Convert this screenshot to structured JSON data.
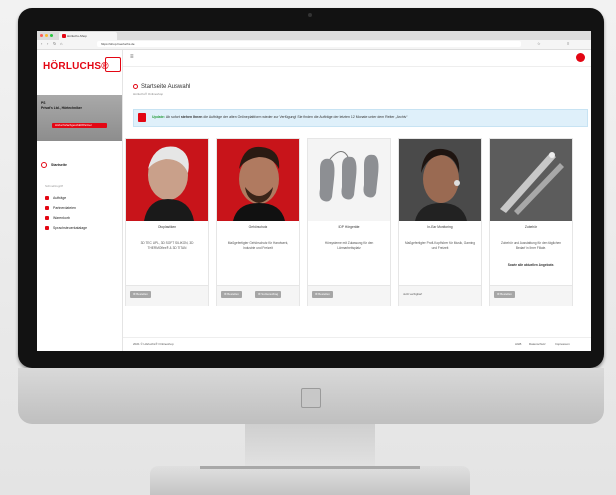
{
  "browser": {
    "tab_title": "Hörluchs-Shop",
    "url": "https://shop.hoerluchs.de"
  },
  "brand": {
    "logo_text": "HÖRLUCHS®",
    "accent": "#e30613"
  },
  "user": {
    "line1": "PS",
    "line2": "Privat's Ltd., Hörtechniker",
    "badge": "Hörluchsfachgeschäft/Partner"
  },
  "sidebar": {
    "home_label": "Startseite",
    "section_label": "Schnellzugriff",
    "items": [
      {
        "label": "Aufträge"
      },
      {
        "label": "Partnerdateien"
      },
      {
        "label": "Warenkorb"
      },
      {
        "label": "Sprachsteuerkatalage"
      }
    ]
  },
  "page": {
    "title": "Startseite Auswahl",
    "breadcrumb": "Hörluchs® Onlineshop"
  },
  "alert": {
    "prefix": "Update:",
    "text_before": "Ab sofort",
    "bold": "stehen Ihnen",
    "text_after": "die Aufträge der alten Onlineplattform wieder zur Verfügung! Sie finden die Aufträge der letzten 12 Monate unter dem Reiter „Archiv“"
  },
  "cards": [
    {
      "title": "Otoplastiken",
      "desc": "3D TEC UPL, 3D SOFT SILIKON, 3D THERMOflex® & 3D TITAN",
      "buttons": [
        "Bestellen"
      ],
      "foot_text": ""
    },
    {
      "title": "Gehörschutz",
      "desc": "Maßgefertigter Gehörschutz für Handwerk, Industrie und Freizeit",
      "buttons": [
        "Bestellen",
        "Sortierauftrag"
      ],
      "foot_text": ""
    },
    {
      "title": "IDP Hörgeräte",
      "desc": "Hörsysteme mit Zulassung für den Lärmarbeitsplatz",
      "buttons": [
        "Bestellen"
      ],
      "foot_text": ""
    },
    {
      "title": "In-Ear Monitoring",
      "desc": "Maßgefertigter Profi-Kopfhörer für Musik, Gaming und Freizeit",
      "buttons": [],
      "foot_text": "Jetzt verfügbar!"
    },
    {
      "title": "Zubehör",
      "desc": "Zubehör und Ausstattung für den täglichen Bedarf in Ihrer Filiale.",
      "extra": "Sowie alle aktuellen Angebote.",
      "buttons": [
        "Bestellen"
      ],
      "foot_text": ""
    }
  ],
  "footer": {
    "copyright": "2021 © Hörluchs® Onlineshop",
    "links": [
      "AGB",
      "Datenschutz",
      "Impressum"
    ]
  }
}
